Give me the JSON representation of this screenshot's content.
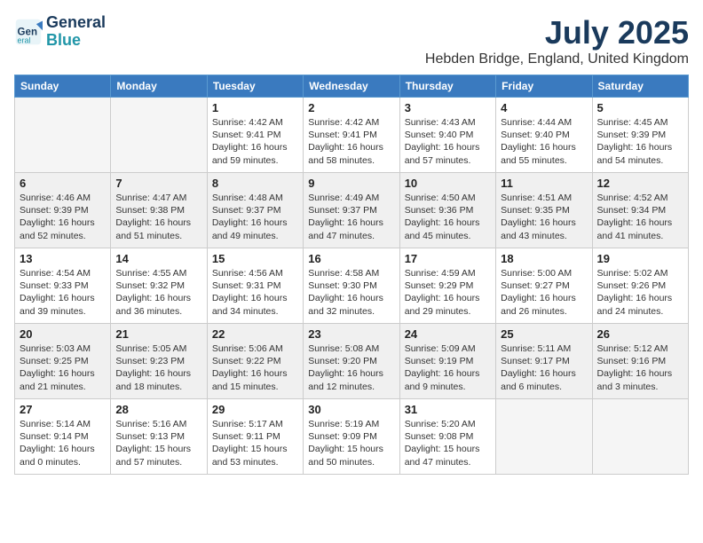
{
  "logo": {
    "line1": "General",
    "line2": "Blue"
  },
  "title": "July 2025",
  "subtitle": "Hebden Bridge, England, United Kingdom",
  "days_of_week": [
    "Sunday",
    "Monday",
    "Tuesday",
    "Wednesday",
    "Thursday",
    "Friday",
    "Saturday"
  ],
  "weeks": [
    [
      {
        "day": "",
        "info": ""
      },
      {
        "day": "",
        "info": ""
      },
      {
        "day": "1",
        "info": "Sunrise: 4:42 AM\nSunset: 9:41 PM\nDaylight: 16 hours and 59 minutes."
      },
      {
        "day": "2",
        "info": "Sunrise: 4:42 AM\nSunset: 9:41 PM\nDaylight: 16 hours and 58 minutes."
      },
      {
        "day": "3",
        "info": "Sunrise: 4:43 AM\nSunset: 9:40 PM\nDaylight: 16 hours and 57 minutes."
      },
      {
        "day": "4",
        "info": "Sunrise: 4:44 AM\nSunset: 9:40 PM\nDaylight: 16 hours and 55 minutes."
      },
      {
        "day": "5",
        "info": "Sunrise: 4:45 AM\nSunset: 9:39 PM\nDaylight: 16 hours and 54 minutes."
      }
    ],
    [
      {
        "day": "6",
        "info": "Sunrise: 4:46 AM\nSunset: 9:39 PM\nDaylight: 16 hours and 52 minutes."
      },
      {
        "day": "7",
        "info": "Sunrise: 4:47 AM\nSunset: 9:38 PM\nDaylight: 16 hours and 51 minutes."
      },
      {
        "day": "8",
        "info": "Sunrise: 4:48 AM\nSunset: 9:37 PM\nDaylight: 16 hours and 49 minutes."
      },
      {
        "day": "9",
        "info": "Sunrise: 4:49 AM\nSunset: 9:37 PM\nDaylight: 16 hours and 47 minutes."
      },
      {
        "day": "10",
        "info": "Sunrise: 4:50 AM\nSunset: 9:36 PM\nDaylight: 16 hours and 45 minutes."
      },
      {
        "day": "11",
        "info": "Sunrise: 4:51 AM\nSunset: 9:35 PM\nDaylight: 16 hours and 43 minutes."
      },
      {
        "day": "12",
        "info": "Sunrise: 4:52 AM\nSunset: 9:34 PM\nDaylight: 16 hours and 41 minutes."
      }
    ],
    [
      {
        "day": "13",
        "info": "Sunrise: 4:54 AM\nSunset: 9:33 PM\nDaylight: 16 hours and 39 minutes."
      },
      {
        "day": "14",
        "info": "Sunrise: 4:55 AM\nSunset: 9:32 PM\nDaylight: 16 hours and 36 minutes."
      },
      {
        "day": "15",
        "info": "Sunrise: 4:56 AM\nSunset: 9:31 PM\nDaylight: 16 hours and 34 minutes."
      },
      {
        "day": "16",
        "info": "Sunrise: 4:58 AM\nSunset: 9:30 PM\nDaylight: 16 hours and 32 minutes."
      },
      {
        "day": "17",
        "info": "Sunrise: 4:59 AM\nSunset: 9:29 PM\nDaylight: 16 hours and 29 minutes."
      },
      {
        "day": "18",
        "info": "Sunrise: 5:00 AM\nSunset: 9:27 PM\nDaylight: 16 hours and 26 minutes."
      },
      {
        "day": "19",
        "info": "Sunrise: 5:02 AM\nSunset: 9:26 PM\nDaylight: 16 hours and 24 minutes."
      }
    ],
    [
      {
        "day": "20",
        "info": "Sunrise: 5:03 AM\nSunset: 9:25 PM\nDaylight: 16 hours and 21 minutes."
      },
      {
        "day": "21",
        "info": "Sunrise: 5:05 AM\nSunset: 9:23 PM\nDaylight: 16 hours and 18 minutes."
      },
      {
        "day": "22",
        "info": "Sunrise: 5:06 AM\nSunset: 9:22 PM\nDaylight: 16 hours and 15 minutes."
      },
      {
        "day": "23",
        "info": "Sunrise: 5:08 AM\nSunset: 9:20 PM\nDaylight: 16 hours and 12 minutes."
      },
      {
        "day": "24",
        "info": "Sunrise: 5:09 AM\nSunset: 9:19 PM\nDaylight: 16 hours and 9 minutes."
      },
      {
        "day": "25",
        "info": "Sunrise: 5:11 AM\nSunset: 9:17 PM\nDaylight: 16 hours and 6 minutes."
      },
      {
        "day": "26",
        "info": "Sunrise: 5:12 AM\nSunset: 9:16 PM\nDaylight: 16 hours and 3 minutes."
      }
    ],
    [
      {
        "day": "27",
        "info": "Sunrise: 5:14 AM\nSunset: 9:14 PM\nDaylight: 16 hours and 0 minutes."
      },
      {
        "day": "28",
        "info": "Sunrise: 5:16 AM\nSunset: 9:13 PM\nDaylight: 15 hours and 57 minutes."
      },
      {
        "day": "29",
        "info": "Sunrise: 5:17 AM\nSunset: 9:11 PM\nDaylight: 15 hours and 53 minutes."
      },
      {
        "day": "30",
        "info": "Sunrise: 5:19 AM\nSunset: 9:09 PM\nDaylight: 15 hours and 50 minutes."
      },
      {
        "day": "31",
        "info": "Sunrise: 5:20 AM\nSunset: 9:08 PM\nDaylight: 15 hours and 47 minutes."
      },
      {
        "day": "",
        "info": ""
      },
      {
        "day": "",
        "info": ""
      }
    ]
  ]
}
